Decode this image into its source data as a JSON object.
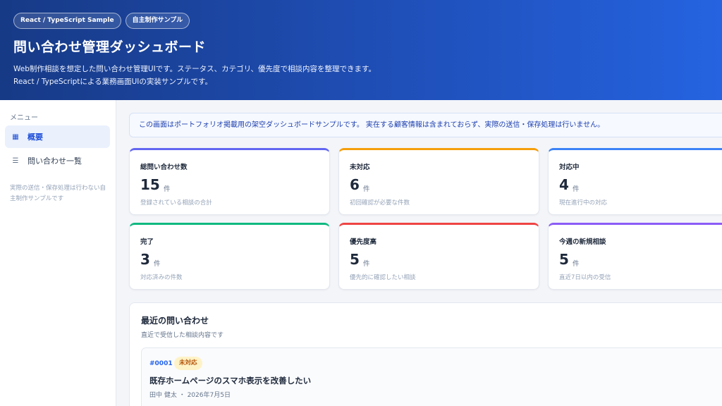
{
  "header": {
    "badges": [
      "React / TypeScript Sample",
      "自主制作サンプル"
    ],
    "title": "問い合わせ管理ダッシュボード",
    "desc_line1": "Web制作相談を想定した問い合わせ管理UIです。ステータス、カテゴリ、優先度で相談内容を整理できます。",
    "desc_line2": "React / TypeScriptによる業務画面UIの実装サンプルです。",
    "gradient": [
      "#173a86",
      "#2563e0"
    ]
  },
  "sidebar": {
    "menu_label": "メニュー",
    "items": [
      {
        "label": "概要",
        "icon": "grid-icon",
        "active": true
      },
      {
        "label": "問い合わせ一覧",
        "icon": "list-icon",
        "active": false
      }
    ],
    "note": "実際の送信・保存処理は行わない自主制作サンプルです"
  },
  "notice": "この画面はポートフォリオ掲載用の架空ダッシュボードサンプルです。 実在する顧客情報は含まれておらず、実際の送信・保存処理は行いません。",
  "stats": [
    {
      "title": "総問い合わせ数",
      "value": "15",
      "unit": "件",
      "note": "登録されている相談の合計",
      "color": "#6366f1"
    },
    {
      "title": "未対応",
      "value": "6",
      "unit": "件",
      "note": "初回確認が必要な件数",
      "color": "#f59e0b"
    },
    {
      "title": "対応中",
      "value": "4",
      "unit": "件",
      "note": "現在進行中の対応",
      "color": "#3b82f6"
    },
    {
      "title": "完了",
      "value": "3",
      "unit": "件",
      "note": "対応済みの件数",
      "color": "#10b981"
    },
    {
      "title": "優先度高",
      "value": "5",
      "unit": "件",
      "note": "優先的に確認したい相談",
      "color": "#ef4444"
    },
    {
      "title": "今週の新規相談",
      "value": "5",
      "unit": "件",
      "note": "直近7日以内の受信",
      "color": "#8b5cf6"
    }
  ],
  "recent": {
    "title": "最近の問い合わせ",
    "subtitle": "直近で受信した相談内容です",
    "items": [
      {
        "id": "#0001",
        "status": "未対応",
        "title": "既存ホームページのスマホ表示を改善したい",
        "meta": "田中 健太 ・ 2026年7月5日"
      }
    ]
  }
}
